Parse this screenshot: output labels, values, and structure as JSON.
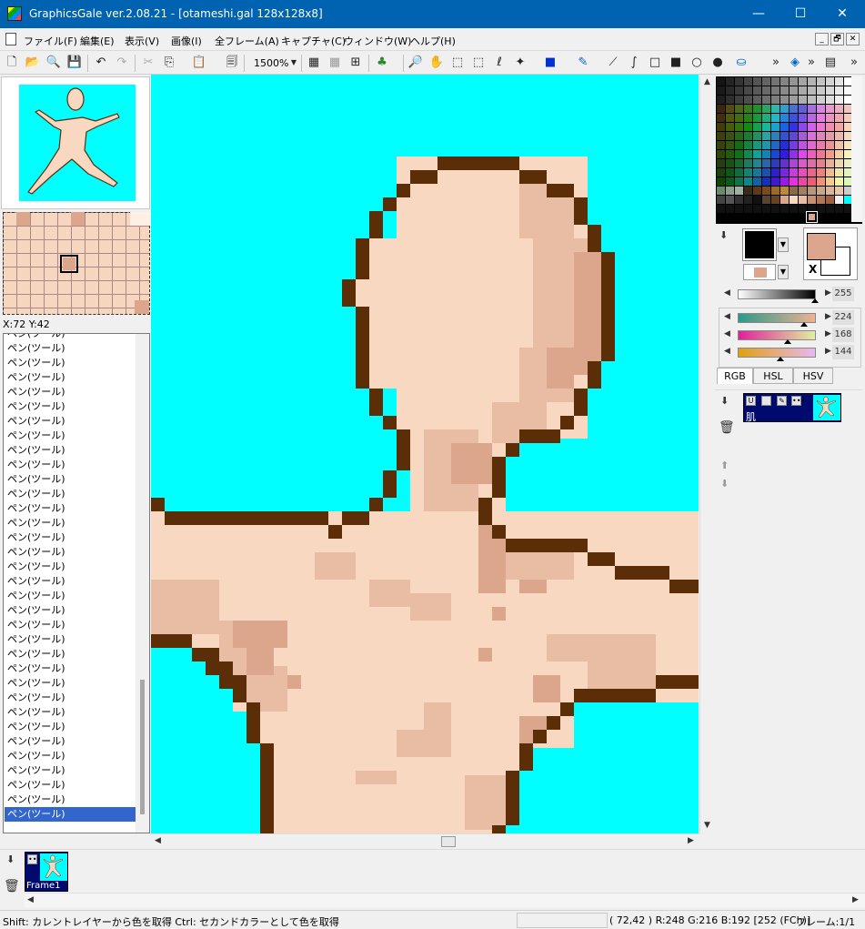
{
  "window": {
    "title": "GraphicsGale ver.2.08.21 - [otameshi.gal 128x128x8]",
    "minimize": "—",
    "maximize": "☐",
    "close": "✕"
  },
  "menu": {
    "items": [
      "ファイル(F)",
      "編集(E)",
      "表示(V)",
      "画像(I)",
      "全フレーム(A)",
      "キャプチャ(C)",
      "ウィンドウ(W)",
      "ヘルプ(H)"
    ],
    "mdi_buttons": [
      "_",
      "🗗",
      "✕"
    ]
  },
  "toolbar": {
    "zoom": "1500%",
    "icons": [
      "new-icon",
      "open-icon",
      "preview-icon",
      "save-icon",
      "undo-icon",
      "redo-icon",
      "cut-icon",
      "copy-icon",
      "paste-icon",
      "paste-new-icon",
      "grid-icon",
      "fine-grid-icon",
      "transform-icon",
      "dropper-layer-icon",
      "zoom-icon",
      "hand-icon",
      "select-rect-icon",
      "select-free-icon",
      "lasso-icon",
      "magic-wand-icon",
      "fill-icon",
      "pen-icon",
      "line-icon",
      "curve-icon",
      "rect-icon",
      "filled-rect-icon",
      "ellipse-icon",
      "filled-ellipse-icon",
      "bucket-icon",
      "more-icon",
      "stamp-icon",
      "more2-icon",
      "monitor-icon",
      "more3-icon"
    ]
  },
  "navigator": {
    "coord": "X:72 Y:42"
  },
  "history": {
    "items": [
      "ペン(ツール)",
      "ペン(ツール)",
      "ペン(ツール)",
      "ペン(ツール)",
      "ペン(ツール)",
      "ペン(ツール)",
      "ペン(ツール)",
      "ペン(ツール)",
      "ペン(ツール)",
      "ペン(ツール)",
      "ペン(ツール)",
      "ペン(ツール)",
      "ペン(ツール)",
      "ペン(ツール)",
      "ペン(ツール)",
      "ペン(ツール)",
      "ペン(ツール)",
      "ペン(ツール)",
      "ペン(ツール)",
      "ペン(ツール)",
      "ペン(ツール)",
      "ペン(ツール)",
      "ペン(ツール)",
      "ペン(ツール)",
      "ペン(ツール)",
      "ペン(ツール)",
      "ペン(ツール)",
      "ペン(ツール)",
      "ペン(ツール)",
      "ペン(ツール)",
      "ペン(ツール)",
      "ペン(ツール)",
      "ペン(ツール)",
      "ペン(ツール)"
    ],
    "selected_index": 33
  },
  "colors": {
    "background": "#00ffff",
    "skin_light": "#f8d8c0",
    "skin_mid": "#e8bda4",
    "skin_dark": "#dba68c",
    "outline": "#5c2e08",
    "selected": "#dba68c"
  },
  "color_panel": {
    "swap_label": "X",
    "gray_value": "255",
    "r_value": "224",
    "g_value": "168",
    "b_value": "144",
    "tabs": [
      "RGB",
      "HSL",
      "HSV"
    ],
    "active_tab": "RGB"
  },
  "layers": {
    "items": [
      {
        "name": "肌"
      }
    ]
  },
  "frames": {
    "items": [
      {
        "name": "Frame1"
      }
    ]
  },
  "status": {
    "hint": "Shift: カレントレイヤーから色を取得   Ctrl: セカンドカラーとして色を取得",
    "pixel_info": "( 72,42 ) R:248 G:216 B:192  [252 (FCh)]",
    "frame_info": "フレーム:1/1"
  }
}
